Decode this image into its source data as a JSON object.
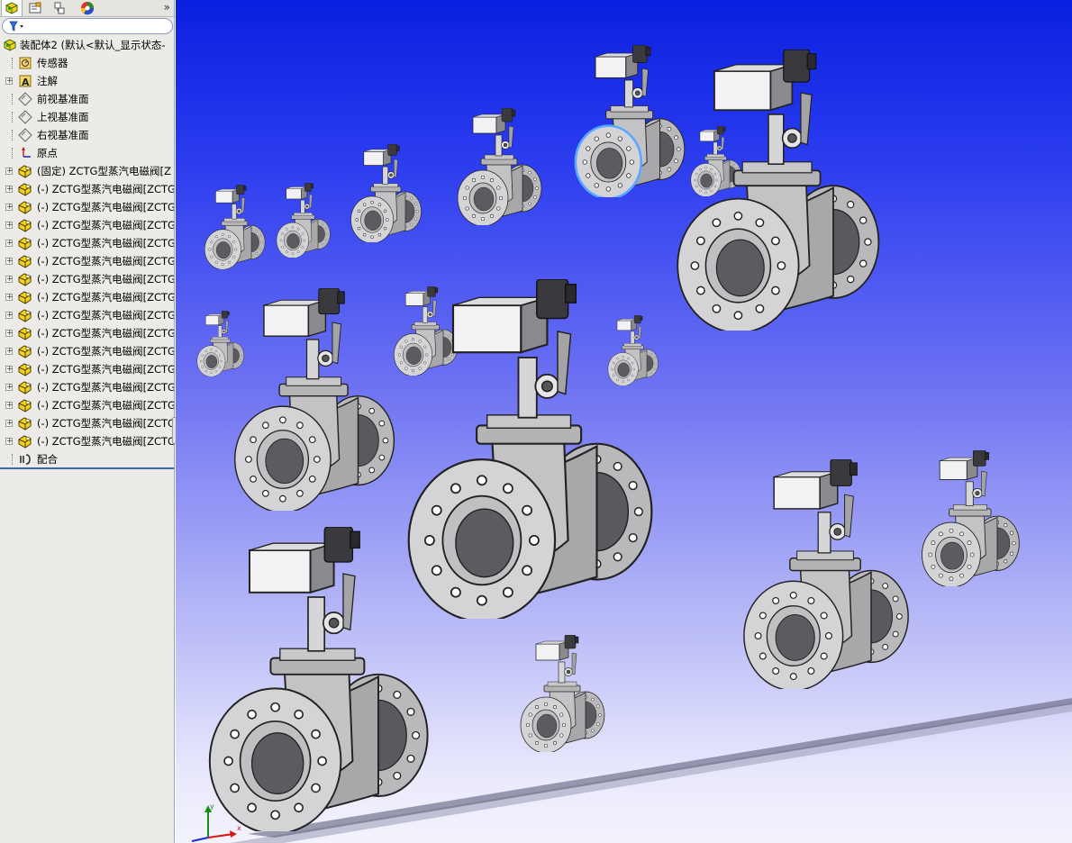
{
  "panel": {
    "tabs": [
      "featuremanager-tab",
      "propertymanager-tab",
      "configurationmanager-tab",
      "display-manager-tab"
    ],
    "expand_label": "»"
  },
  "tree": {
    "root_label": "装配体2  (默认<默认_显示状态-",
    "items": [
      {
        "label": "传感器",
        "icon": "sensor-icon",
        "expander": false
      },
      {
        "label": "注解",
        "icon": "annotation-icon",
        "expander": true
      },
      {
        "label": "前视基准面",
        "icon": "plane-icon",
        "expander": false
      },
      {
        "label": "上视基准面",
        "icon": "plane-icon",
        "expander": false
      },
      {
        "label": "右视基准面",
        "icon": "plane-icon",
        "expander": false
      },
      {
        "label": "原点",
        "icon": "origin-icon",
        "expander": false
      },
      {
        "label": "(固定) ZCTG型蒸汽电磁阀[Z",
        "icon": "part-icon",
        "expander": true
      },
      {
        "label": "(-) ZCTG型蒸汽电磁阀[ZCTG",
        "icon": "part-icon",
        "expander": true
      },
      {
        "label": "(-) ZCTG型蒸汽电磁阀[ZCTG",
        "icon": "part-icon",
        "expander": true
      },
      {
        "label": "(-) ZCTG型蒸汽电磁阀[ZCTG",
        "icon": "part-icon",
        "expander": true
      },
      {
        "label": "(-) ZCTG型蒸汽电磁阀[ZCTG",
        "icon": "part-icon",
        "expander": true
      },
      {
        "label": "(-) ZCTG型蒸汽电磁阀[ZCTG",
        "icon": "part-icon",
        "expander": true
      },
      {
        "label": "(-) ZCTG型蒸汽电磁阀[ZCTG",
        "icon": "part-icon",
        "expander": true
      },
      {
        "label": "(-) ZCTG型蒸汽电磁阀[ZCTG",
        "icon": "part-icon",
        "expander": true
      },
      {
        "label": "(-) ZCTG型蒸汽电磁阀[ZCTG",
        "icon": "part-icon",
        "expander": true
      },
      {
        "label": "(-) ZCTG型蒸汽电磁阀[ZCTG",
        "icon": "part-icon",
        "expander": true
      },
      {
        "label": "(-) ZCTG型蒸汽电磁阀[ZCTG",
        "icon": "part-icon",
        "expander": true
      },
      {
        "label": "(-) ZCTG型蒸汽电磁阀[ZCTG",
        "icon": "part-icon",
        "expander": true
      },
      {
        "label": "(-) ZCTG型蒸汽电磁阀[ZCTG",
        "icon": "part-icon",
        "expander": true
      },
      {
        "label": "(-) ZCTG型蒸汽电磁阀[ZCTG",
        "icon": "part-icon",
        "expander": true
      },
      {
        "label": "(-) ZCTG型蒸汽电磁阀[ZCTG",
        "icon": "part-icon",
        "expander": true
      },
      {
        "label": "(-) ZCTG型蒸汽电磁阀[ZCTG",
        "icon": "part-icon",
        "expander": true
      },
      {
        "label": "配合",
        "icon": "mates-icon",
        "expander": false
      }
    ]
  },
  "viewport": {
    "background_top": "#0a1fe0",
    "background_bottom": "#f3f3fd",
    "model_color": "#b9b9bc",
    "selection_color": "#5aa8ff",
    "triad_axes": [
      "x",
      "y",
      "z"
    ]
  }
}
